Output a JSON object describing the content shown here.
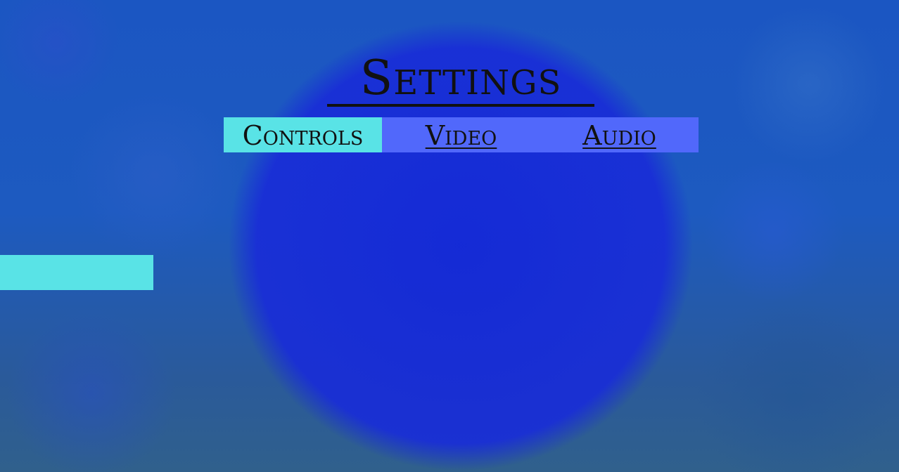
{
  "screen": {
    "title": "Settings"
  },
  "tabs": [
    {
      "label": "Controls",
      "active": true
    },
    {
      "label": "Video",
      "active": false
    },
    {
      "label": "Audio",
      "active": false
    }
  ],
  "side_panel": {
    "label": ""
  },
  "colors": {
    "tab_bar": "#5168fb",
    "tab_active": "#59e3e6",
    "side_bar": "#59e3e6",
    "text": "#111111",
    "background_center": "#1428d7",
    "background_edge": "#1d5ac0"
  }
}
